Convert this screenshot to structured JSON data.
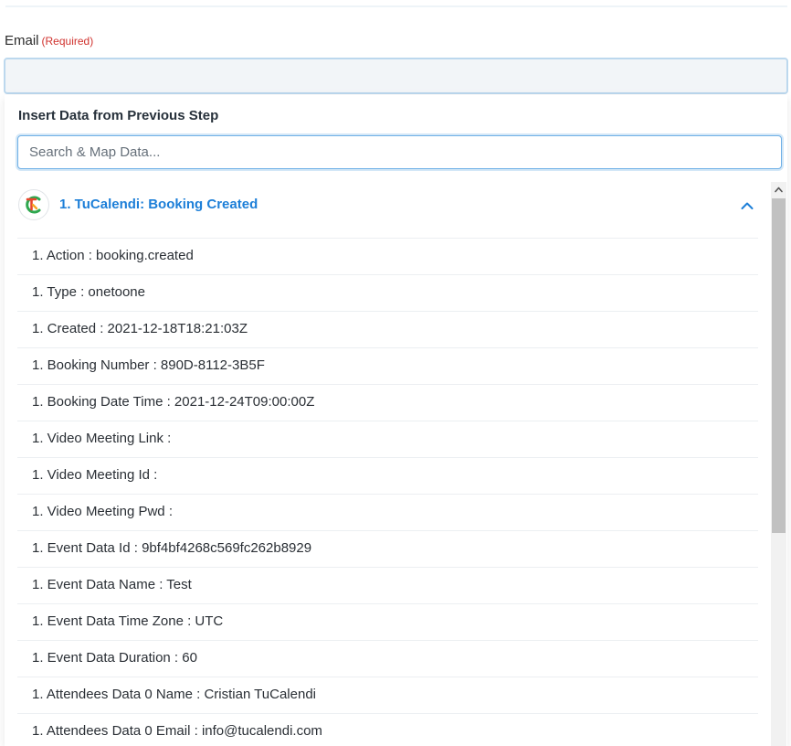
{
  "email_field": {
    "label": "Email",
    "required_tag": "(Required)",
    "value": ""
  },
  "panel": {
    "heading": "Insert Data from Previous Step",
    "search_placeholder": "Search & Map Data..."
  },
  "step": {
    "title": "1. TuCalendi: Booking Created",
    "logo_icon": "tucalendi-logo-icon",
    "toggle_icon": "chevron-up-icon",
    "items": [
      {
        "label": "1. Action : booking.created"
      },
      {
        "label": "1. Type : onetoone"
      },
      {
        "label": "1. Created : 2021-12-18T18:21:03Z"
      },
      {
        "label": "1. Booking Number : 890D-8112-3B5F"
      },
      {
        "label": "1. Booking Date Time : 2021-12-24T09:00:00Z"
      },
      {
        "label": "1. Video Meeting Link :"
      },
      {
        "label": "1. Video Meeting Id :"
      },
      {
        "label": "1. Video Meeting Pwd :"
      },
      {
        "label": "1. Event Data Id : 9bf4bf4268c569fc262b8929"
      },
      {
        "label": "1. Event Data Name : Test"
      },
      {
        "label": "1. Event Data Time Zone : UTC"
      },
      {
        "label": "1. Event Data Duration : 60"
      },
      {
        "label": "1. Attendees Data 0 Name : Cristian TuCalendi"
      },
      {
        "label": "1. Attendees Data 0 Email : info@tucalendi.com"
      }
    ]
  },
  "colors": {
    "accent": "#1d7fd8",
    "required": "#d0312d",
    "input_border": "#bcd8ee",
    "logo_red": "#e8452c",
    "logo_orange": "#f5a623",
    "logo_green": "#2fa84f"
  }
}
